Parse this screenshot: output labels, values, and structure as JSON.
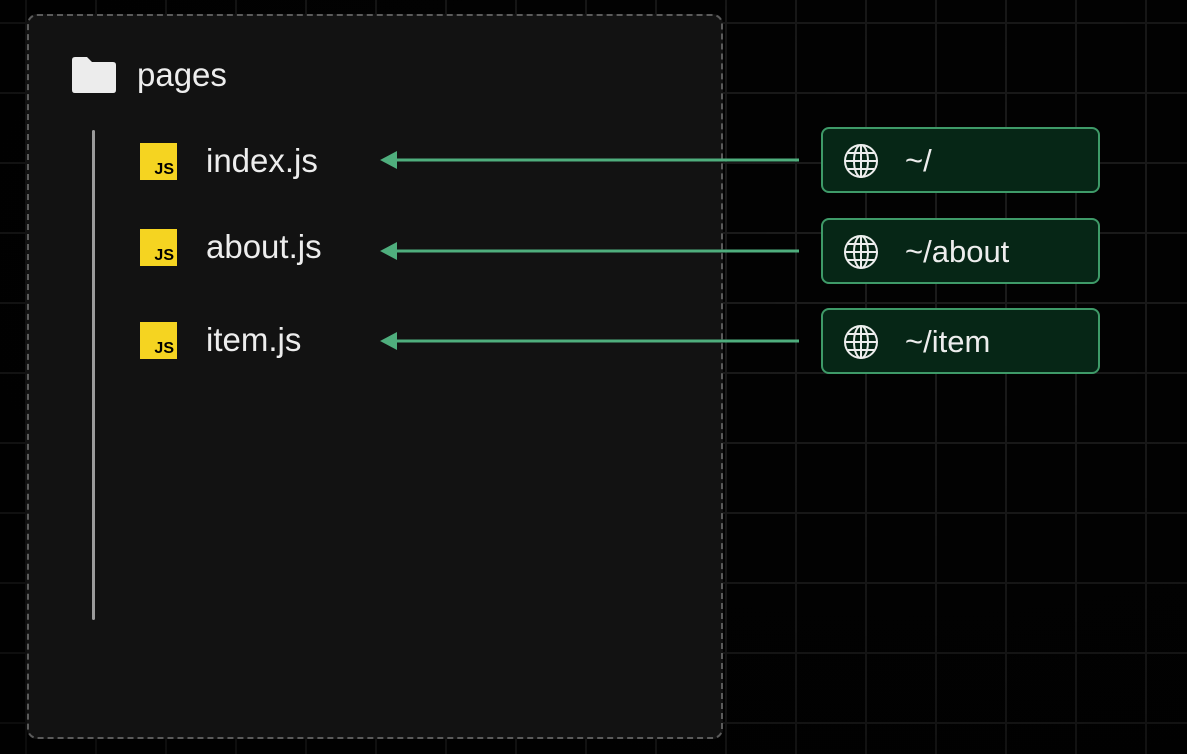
{
  "folder": {
    "name": "pages",
    "icon": "folder-icon"
  },
  "files": [
    {
      "name": "index.js",
      "badge": "JS",
      "icon": "javascript-file-icon"
    },
    {
      "name": "about.js",
      "badge": "JS",
      "icon": "javascript-file-icon"
    },
    {
      "name": "item.js",
      "badge": "JS",
      "icon": "javascript-file-icon"
    }
  ],
  "routes": [
    {
      "path": "~/",
      "icon": "globe-icon"
    },
    {
      "path": "~/about",
      "icon": "globe-icon"
    },
    {
      "path": "~/item",
      "icon": "globe-icon"
    }
  ],
  "colors": {
    "background": "#020202",
    "panel": "#121212",
    "panel_border": "#5b5b5b",
    "arrow": "#4fae7d",
    "route_border": "#3e9a68",
    "route_fill": "#062616",
    "js_badge": "#f5d421",
    "text": "#ededed"
  }
}
